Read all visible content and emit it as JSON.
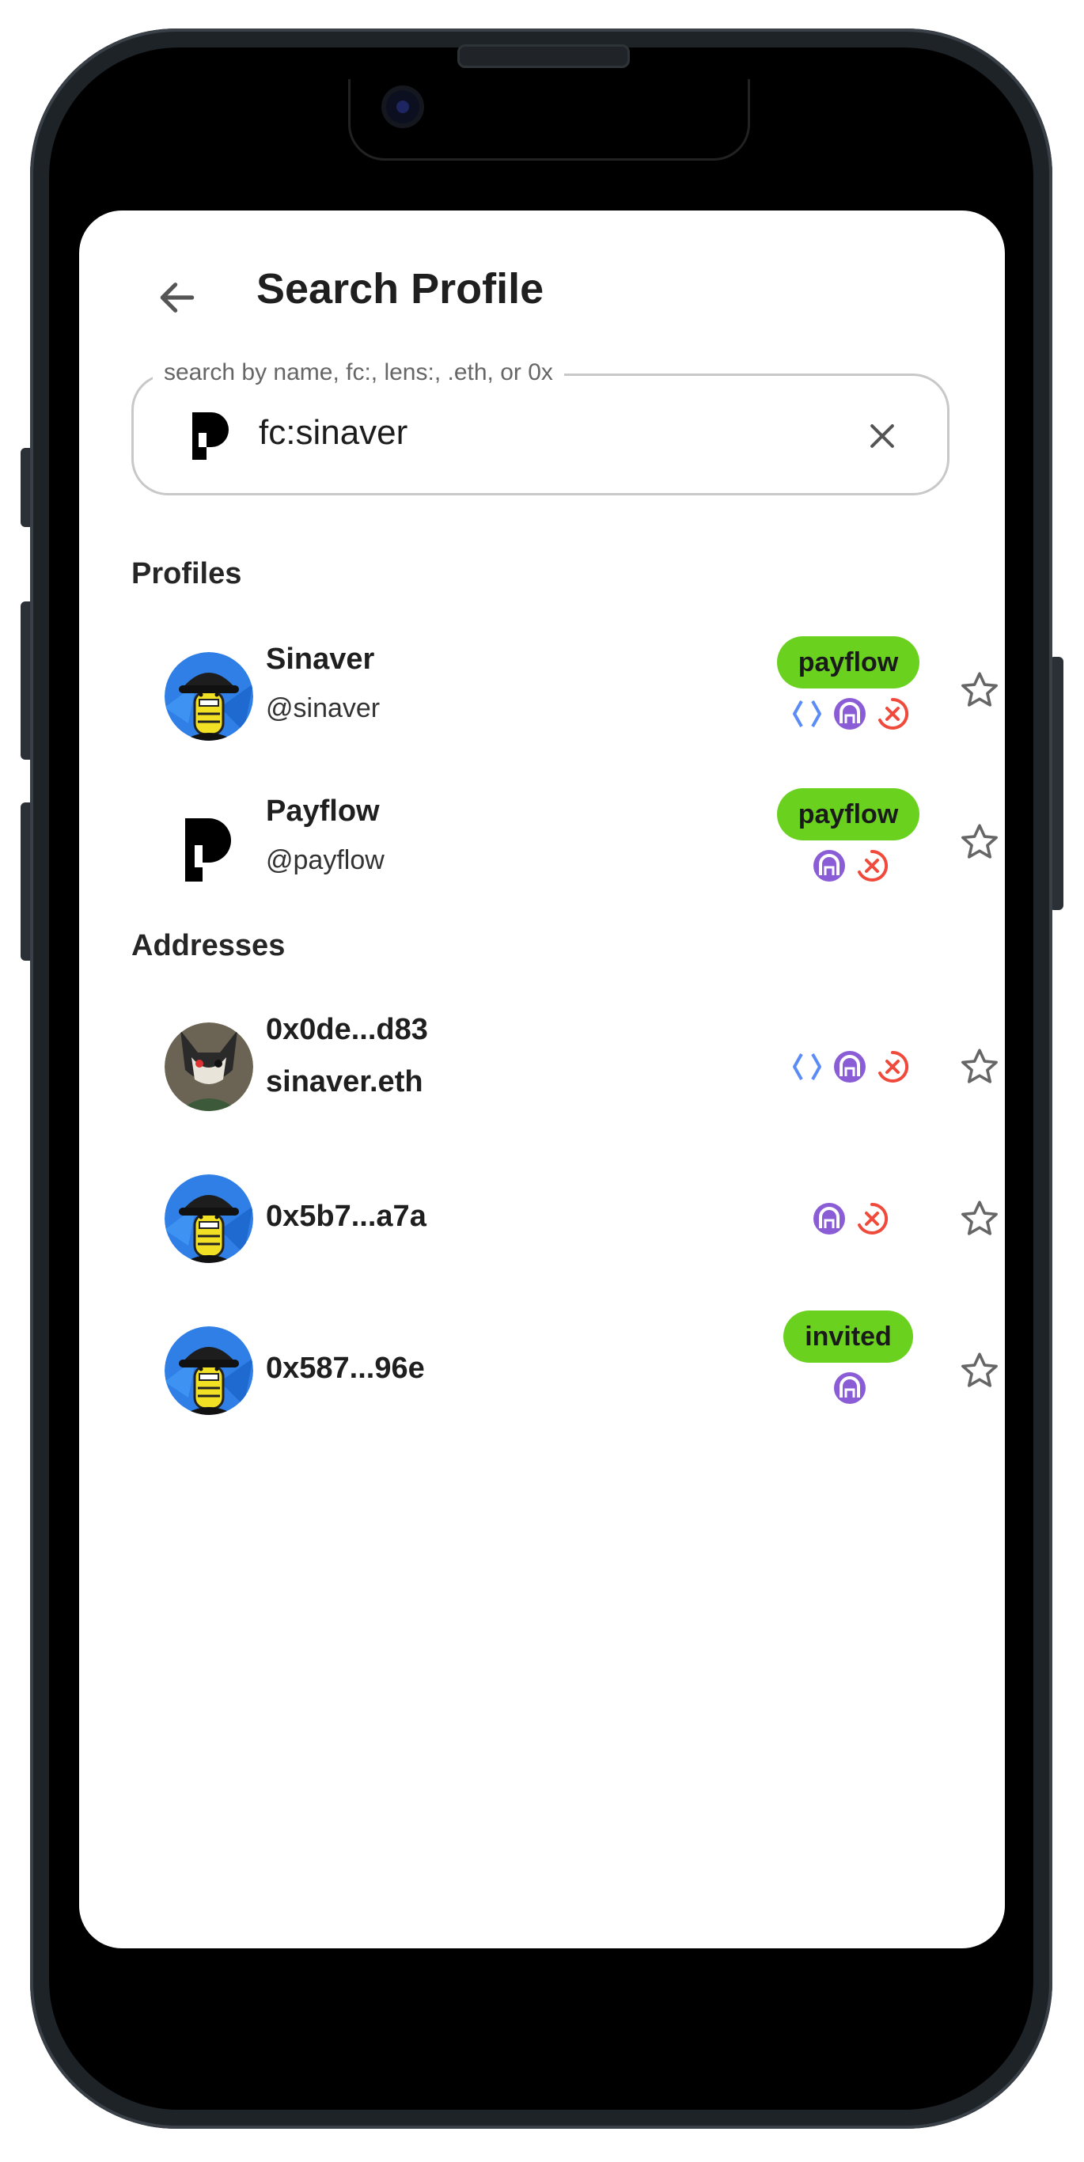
{
  "header": {
    "title": "Search Profile"
  },
  "search": {
    "legend": "search by name, fc:, lens:, .eth, or 0x",
    "value": "fc:sinaver"
  },
  "sections": {
    "profiles_label": "Profiles",
    "addresses_label": "Addresses"
  },
  "profiles": [
    {
      "name": "Sinaver",
      "handle": "@sinaver",
      "badge": "payflow",
      "protocols": [
        "ens-icon",
        "lens-icon",
        "xmtp-icon"
      ]
    },
    {
      "name": "Payflow",
      "handle": "@payflow",
      "badge": "payflow",
      "protocols": [
        "lens-icon",
        "xmtp-icon"
      ]
    }
  ],
  "addresses": [
    {
      "address": "0x0de...d83",
      "ens": "sinaver.eth",
      "protocols": [
        "ens-icon",
        "lens-icon",
        "xmtp-icon"
      ]
    },
    {
      "address": "0x5b7...a7a",
      "protocols": [
        "lens-icon",
        "xmtp-icon"
      ]
    },
    {
      "address": "0x587...96e",
      "badge": "invited",
      "protocols": [
        "lens-icon"
      ]
    }
  ],
  "colors": {
    "badge": "#6bd11f",
    "ens": "#5b8cf5",
    "lens": "#8a5cd6",
    "xmtp": "#ef4a3c",
    "avatar_blue": "#2f7fe6",
    "avatar_yellow": "#f2e024"
  }
}
